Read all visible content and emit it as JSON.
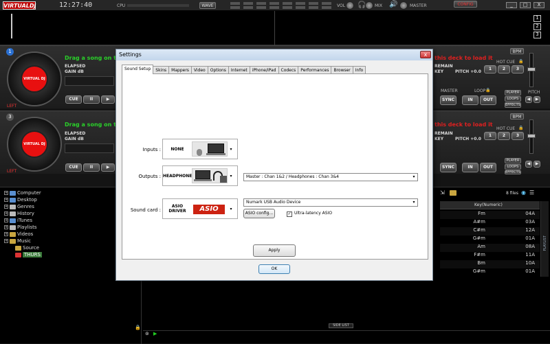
{
  "topbar": {
    "logo": "VIRTUALDJ",
    "clock": "12:27:40",
    "cpu_label": "CPU",
    "wave_label": "WAVE",
    "vol_label": "VOL",
    "mix_label": "MIX",
    "master_label": "MASTER",
    "config_label": "CONFIG",
    "win_min": "_",
    "win_max": "□",
    "win_close": "X"
  },
  "waveform": {
    "slots": [
      "1",
      "2",
      "3"
    ]
  },
  "deck1": {
    "number": "1",
    "drag_text": "Drag a song on thi",
    "load_text": "this deck to load it",
    "elapsed": "ELAPSED",
    "gain": "GAIN dB",
    "remain": "REMAIN",
    "key": "KEY",
    "pitch": "PITCH +0.0",
    "bpm": "BPM",
    "hotcue": "HOT CUE",
    "hot1": "1",
    "hot2": "2",
    "hot3": "3",
    "cue": "CUE",
    "pause": "II",
    "play": "▶",
    "sync": "SYNC",
    "master": "MASTER",
    "loop": "LOOP",
    "in": "IN",
    "out": "OUT",
    "player": "PLAYER",
    "loops": "LOOPS",
    "effects": "EFFECTS",
    "pitch_label": "PITCH",
    "side": "LEFT"
  },
  "deck2": {
    "number": "3",
    "drag_text": "Drag a song on thi",
    "load_text": "this deck to load it",
    "elapsed": "ELAPSED",
    "gain": "GAIN dB",
    "remain": "REMAIN",
    "key": "KEY",
    "pitch": "PITCH +0.0",
    "bpm": "BPM",
    "hotcue": "HOT CUE",
    "hot1": "1",
    "hot2": "2",
    "hot3": "3",
    "cue": "CUE",
    "pause": "II",
    "play": "▶",
    "sync": "SYNC",
    "in": "IN",
    "out": "OUT",
    "player": "PLAYER",
    "loops": "LOOPS",
    "effects": "EFFECTS",
    "side": "LEFT"
  },
  "turntable_label": "VIRTUAL DJ",
  "browser": {
    "tree": [
      {
        "label": "Computer",
        "icon": "computer-icon",
        "expander": "+"
      },
      {
        "label": "Desktop",
        "icon": "desktop-icon",
        "expander": "+"
      },
      {
        "label": "Genres",
        "icon": "genres-icon",
        "expander": "+"
      },
      {
        "label": "History",
        "icon": "history-icon",
        "expander": "+"
      },
      {
        "label": "iTunes",
        "icon": "itunes-icon",
        "expander": "+"
      },
      {
        "label": "Playlists",
        "icon": "playlists-icon",
        "expander": "+"
      },
      {
        "label": "Videos",
        "icon": "folder-icon",
        "expander": "+"
      },
      {
        "label": "Music",
        "icon": "folder-icon",
        "expander": "+"
      },
      {
        "label": "Source",
        "icon": "folder-icon",
        "expander": ""
      },
      {
        "label": "THURS",
        "icon": "folder-red-icon",
        "expander": ""
      }
    ],
    "file_count": "8 files",
    "col_keynum": "Key(Numeric)",
    "rows": [
      {
        "key": "Fm",
        "keynum": "04A"
      },
      {
        "key": "A#m",
        "keynum": "03A"
      },
      {
        "key": "C#m",
        "keynum": "12A"
      },
      {
        "key": "G#m",
        "keynum": "01A"
      },
      {
        "key": "Am",
        "keynum": "08A"
      },
      {
        "key": "F#m",
        "keynum": "11A"
      },
      {
        "key": "Bm",
        "keynum": "10A"
      },
      {
        "key": "G#m",
        "keynum": "01A"
      }
    ],
    "side_list": "SIDE LIST",
    "playlist_tab": "PLAYLIST"
  },
  "dialog": {
    "title": "Settings",
    "close": "x",
    "tabs": [
      "Sound Setup",
      "Skins",
      "Mappers",
      "Video",
      "Options",
      "Internet",
      "iPhone/iPad",
      "Codecs",
      "Performances",
      "Browser",
      "Info"
    ],
    "inputs_label": "Inputs :",
    "inputs_device": "NONE",
    "outputs_label": "Outputs :",
    "outputs_device": "HEADPHONES",
    "outputs_value": "Master : Chan 1&2 / Headphones : Chan 3&4",
    "soundcard_label": "Sound card :",
    "soundcard_device": "ASIO DRIVER",
    "soundcard_logo": "ASIO",
    "soundcard_value": "Numark USB Audio Device",
    "asio_config": "ASIO config...",
    "ultra_latency": "Ultra-latency ASIO",
    "ultra_checked": "✓",
    "apply": "Apply",
    "ok": "OK",
    "dropdown_arrow": "▾"
  }
}
